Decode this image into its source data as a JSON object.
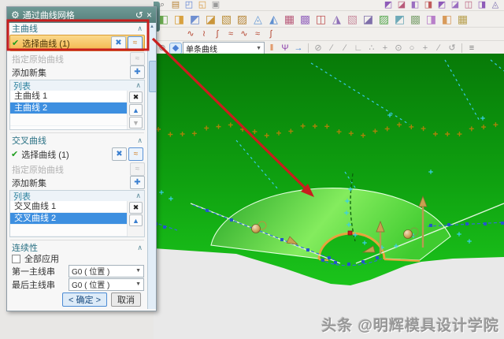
{
  "colors": {
    "accent": "#3d8fe0",
    "selection_highlight": "#f7c259",
    "annotation_red": "#c81e1e",
    "surface_green": "#3fd32f",
    "background_green": "#0fa110",
    "title_teal": "#5e8f8a"
  },
  "toolbar": {
    "row1_left": [
      {
        "name": "zoom-tool-icon",
        "glyph": "⌕",
        "color": "#6a6a6a"
      },
      {
        "name": "notebook-icon",
        "glyph": "▤",
        "color": "#b9863a"
      },
      {
        "name": "extrude-feature-icon",
        "glyph": "◰",
        "color": "#5b7fd4"
      },
      {
        "name": "pad-feature-icon",
        "glyph": "◱",
        "color": "#d8973a"
      },
      {
        "name": "blank-feature-icon",
        "glyph": "▣",
        "color": "#9a9a9a"
      }
    ],
    "row1_right": [
      {
        "name": "sheet-feature-icon-1",
        "glyph": "◩",
        "color": "#8e5bb8"
      },
      {
        "name": "sheet-feature-icon-2",
        "glyph": "◪",
        "color": "#b85a7a"
      },
      {
        "name": "sheet-feature-icon-3",
        "glyph": "◧",
        "color": "#9a6ec0"
      },
      {
        "name": "sheet-feature-icon-4",
        "glyph": "◨",
        "color": "#c05a5a"
      },
      {
        "name": "sheet-feature-icon-5",
        "glyph": "◩",
        "color": "#8e5bb8"
      },
      {
        "name": "sheet-feature-icon-6",
        "glyph": "◪",
        "color": "#9a6ec0"
      },
      {
        "name": "sheet-feature-icon-7",
        "glyph": "◫",
        "color": "#b85a7a"
      },
      {
        "name": "sheet-feature-icon-8",
        "glyph": "◨",
        "color": "#8e5bb8"
      },
      {
        "name": "sheet-feature-icon-9",
        "glyph": "◬",
        "color": "#7d6fb0"
      }
    ],
    "row2": [
      {
        "name": "datum-plane-icon",
        "glyph": "◧",
        "color": "#6aa84f"
      },
      {
        "name": "sketch-icon",
        "glyph": "◨",
        "color": "#d8a13f"
      },
      {
        "name": "block-icon",
        "glyph": "◩",
        "color": "#6f8fd0"
      },
      {
        "name": "boss-icon",
        "glyph": "◪",
        "color": "#c9953a"
      },
      {
        "name": "scoop-icon",
        "glyph": "▧",
        "color": "#bb8f3a"
      },
      {
        "name": "pocket-icon",
        "glyph": "▨",
        "color": "#b8873a"
      },
      {
        "name": "sphere-icon",
        "glyph": "◬",
        "color": "#6f9fd6"
      },
      {
        "name": "cylinder-icon",
        "glyph": "◭",
        "color": "#5f8fd0"
      },
      {
        "name": "bounded-plane-icon",
        "glyph": "▦",
        "color": "#b85a7a"
      },
      {
        "name": "ruled-icon",
        "glyph": "▩",
        "color": "#9a6ec0"
      },
      {
        "name": "through-curves-icon",
        "glyph": "◫",
        "color": "#c05555"
      },
      {
        "name": "swept-icon",
        "glyph": "◮",
        "color": "#8f6fb8"
      },
      {
        "name": "n-sided-icon",
        "glyph": "▧",
        "color": "#c98fa0"
      },
      {
        "name": "mesh-surface-icon",
        "glyph": "◪",
        "color": "#7f6faa"
      },
      {
        "name": "studio-surface-icon",
        "glyph": "▨",
        "color": "#57a84f"
      },
      {
        "name": "offset-surface-icon",
        "glyph": "◩",
        "color": "#6faab8"
      },
      {
        "name": "trimmed-sheet-icon",
        "glyph": "▩",
        "color": "#87a87a"
      },
      {
        "name": "sew-icon",
        "glyph": "◨",
        "color": "#b87fc9"
      },
      {
        "name": "patch-icon",
        "glyph": "◧",
        "color": "#d89a5a"
      },
      {
        "name": "thicken-icon",
        "glyph": "▦",
        "color": "#b8a04f"
      }
    ],
    "row3": [
      {
        "name": "spline-icon",
        "glyph": "∿",
        "color": "#b5452f"
      },
      {
        "name": "studio-spline-icon",
        "glyph": "≀",
        "color": "#b5452f"
      },
      {
        "name": "fit-curve-icon",
        "glyph": "∫",
        "color": "#b5452f"
      },
      {
        "name": "curve-on-surface-icon",
        "glyph": "≈",
        "color": "#b5452f"
      },
      {
        "name": "bridge-curve-icon",
        "glyph": "∿",
        "color": "#b5452f"
      },
      {
        "name": "offset-curve-icon",
        "glyph": "≈",
        "color": "#b5452f"
      },
      {
        "name": "project-curve-icon",
        "glyph": "∫",
        "color": "#b5452f"
      }
    ],
    "selection": {
      "filter_value": "单条曲线",
      "icons_left": [
        {
          "name": "no-selection-filter-icon",
          "glyph": "⊘",
          "color": "#8a8a8a"
        },
        {
          "name": "solid-body-filter-icon",
          "glyph": "◆",
          "color": "#4a7fd4",
          "active": true
        }
      ],
      "icons_mid": [
        {
          "name": "within-work-part-icon",
          "glyph": "‖",
          "color": "#d8641a"
        },
        {
          "name": "snap-point-toggle-icon",
          "glyph": "Ψ",
          "color": "#8e44ad"
        },
        {
          "name": "select-enter-icon",
          "glyph": "→",
          "color": "#3a7fd0"
        }
      ],
      "icons_snap": [
        {
          "name": "snap-endpoint-icon",
          "glyph": "⊘",
          "color": "#9c9c9c"
        },
        {
          "name": "snap-line-icon",
          "glyph": "∕",
          "color": "#9c9c9c"
        },
        {
          "name": "snap-segment-icon",
          "glyph": "∕",
          "color": "#9c9c9c"
        },
        {
          "name": "snap-corner-icon",
          "glyph": "∟",
          "color": "#9c9c9c"
        },
        {
          "name": "snap-arc-icon",
          "glyph": "∴",
          "color": "#9c9c9c"
        },
        {
          "name": "snap-midpoint-icon",
          "glyph": "+",
          "color": "#9c9c9c"
        },
        {
          "name": "snap-center-icon",
          "glyph": "⊙",
          "color": "#9c9c9c"
        },
        {
          "name": "snap-circle-icon",
          "glyph": "○",
          "color": "#9c9c9c"
        },
        {
          "name": "snap-intersection-icon",
          "glyph": "+",
          "color": "#9c9c9c"
        },
        {
          "name": "snap-tangent-icon",
          "glyph": "∕",
          "color": "#9c9c9c"
        },
        {
          "name": "snap-rotate-icon",
          "glyph": "↺",
          "color": "#9c9c9c"
        }
      ],
      "icon_last": {
        "name": "layers-icon",
        "glyph": "≡",
        "color": "#777777"
      }
    }
  },
  "dialog": {
    "title": "通过曲线网格",
    "gear_icon": "⚙",
    "reset_icon": "↺",
    "close_icon": "×",
    "collapse_icon": "∧",
    "main_curve": {
      "header": "主曲线",
      "check": "✔",
      "select_row": "选择曲线 (1)",
      "specify_row": "指定原始曲线",
      "add_row": "添加新集",
      "list_header": "列表",
      "rows": [
        {
          "label": "主曲线 1"
        },
        {
          "label": "主曲线 2",
          "selected": true
        },
        {
          "label": ""
        }
      ]
    },
    "cross_curve": {
      "header": "交叉曲线",
      "check": "✔",
      "select_row": "选择曲线 (1)",
      "specify_row": "指定原始曲线",
      "add_row": "添加新集",
      "list_header": "列表",
      "rows": [
        {
          "label": "交叉曲线 1"
        },
        {
          "label": "交叉曲线 2",
          "selected": true
        },
        {
          "label": ""
        }
      ]
    },
    "continuity": {
      "header": "连续性",
      "apply_all": "全部应用",
      "first_label": "第一主线串",
      "first_value": "G0 ( 位置 )",
      "last_label": "最后主线串",
      "last_value": "G0 ( 位置 )"
    },
    "ok": "< 确定 >",
    "cancel": "取消"
  },
  "viewport": {
    "watermark": "头条 @明辉模具设计学院"
  }
}
